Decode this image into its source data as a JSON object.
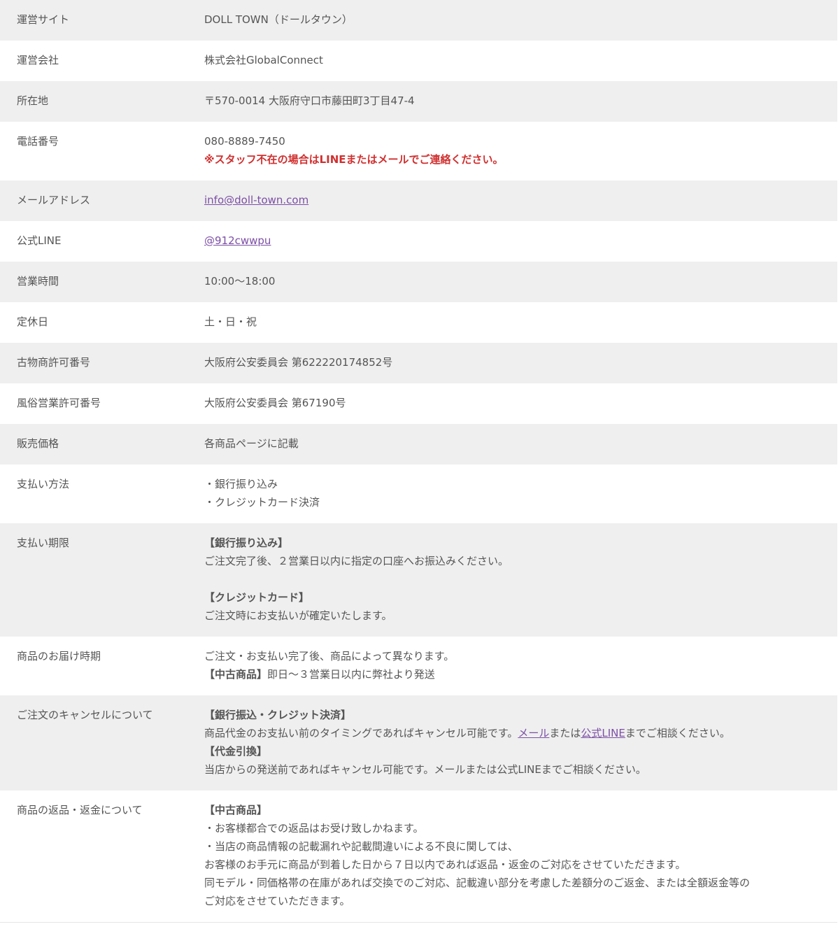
{
  "rows": [
    {
      "label": "運営サイト",
      "value": "DOLL TOWN（ドールタウン）"
    },
    {
      "label": "運営会社",
      "value": "株式会社GlobalConnect"
    },
    {
      "label": "所在地",
      "value": "〒570-0014 大阪府守口市藤田町3丁目47-4"
    },
    {
      "label": "電話番号",
      "value": "080-8889-7450",
      "note": "※スタッフ不在の場合はLINEまたはメールでご連絡ください。"
    },
    {
      "label": "メールアドレス",
      "link": "info@doll-town.com"
    },
    {
      "label": "公式LINE",
      "link": "@912cwwpu"
    },
    {
      "label": "営業時間",
      "value": "10:00〜18:00"
    },
    {
      "label": "定休日",
      "value": "土・日・祝"
    },
    {
      "label": "古物商許可番号",
      "value": "大阪府公安委員会 第622220174852号"
    },
    {
      "label": "風俗営業許可番号",
      "value": "大阪府公安委員会 第67190号"
    },
    {
      "label": "販売価格",
      "value": "各商品ページに記載"
    },
    {
      "label": "支払い方法",
      "lines": [
        "・銀行振り込み",
        "・クレジットカード決済"
      ]
    },
    {
      "label": "支払い期限",
      "bank_heading": "【銀行振り込み】",
      "bank_text": "ご注文完了後、２営業日以内に指定の口座へお振込みください。",
      "card_heading": "【クレジットカード】",
      "card_text": "ご注文時にお支払いが確定いたします。"
    },
    {
      "label": "商品のお届け時期",
      "text": "ご注文・お支払い完了後、商品によって異なります。",
      "used_heading": "【中古商品】",
      "used_text": "即日〜３営業日以内に弊社より発送"
    },
    {
      "label": "ご注文のキャンセルについて",
      "heading1": "【銀行振込・クレジット決済】",
      "text1_before": "商品代金のお支払い前のタイミングであればキャンセル可能です。",
      "link_mail": "メール",
      "text1_mid": "または",
      "link_line": "公式LINE",
      "text1_after": "までご相談ください。",
      "heading2": "【代金引換】",
      "text2": "当店からの発送前であればキャンセル可能です。メールまたは公式LINEまでご相談ください。"
    },
    {
      "label": "商品の返品・返金について",
      "heading": "【中古商品】",
      "lines": [
        "・お客様都合での返品はお受け致しかねます。",
        "・当店の商品情報の記載漏れや記載間違いによる不良に関しては、",
        "お客様のお手元に商品が到着した日から７日以内であれば返品・返金のご対応をさせていただきます。",
        "同モデル・同価格帯の在庫があれば交換でのご対応、記載違い部分を考慮した差額分のご返金、または全額返金等の",
        "ご対応をさせていただきます。"
      ]
    }
  ],
  "colors": {
    "shade": "#efefef",
    "text": "#555555",
    "warning": "#d12f2f",
    "link": "#7c4fa6"
  }
}
